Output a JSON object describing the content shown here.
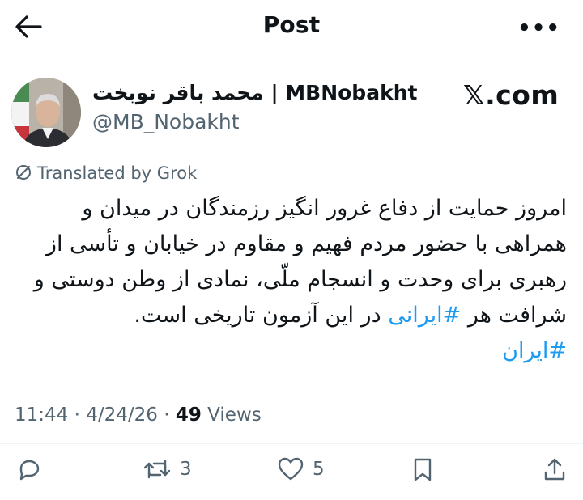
{
  "header": {
    "title": "Post",
    "back_icon": "back-arrow-icon",
    "more_icon": "more-icon"
  },
  "author": {
    "name": "محمد باقر نوبخت | MBNobakht",
    "handle": "@MB_Nobakht",
    "avatar_icon": "avatar"
  },
  "watermark": {
    "text": "𝕏.com"
  },
  "translation": {
    "label": "Translated by Grok",
    "icon": "translate-icon"
  },
  "post": {
    "text_lines": [
      "امروز حمایت از دفاع غرور انگیز رزمندگان در میدان و",
      "همراهی با حضور مردم فهیم و مقاوم در خیابان و تأسی از",
      "رهبری برای وحدت و انسجام ملّی، نمادی از وطن دوستی و"
    ],
    "line4_before": "شرافت هر ",
    "line4_hashtag": "#ایرانی",
    "line4_after": " در این آزمون تاریخی است.",
    "hashtag_line": "#ایران"
  },
  "meta": {
    "time": "11:44",
    "sep1": " · ",
    "date": "4/24/26",
    "sep2": " · ",
    "views_count": "49",
    "views_label": " Views"
  },
  "actions": {
    "reply_count": "",
    "repost_count": "3",
    "like_count": "5"
  },
  "colors": {
    "link": "#1d9bf0",
    "secondary": "#536471",
    "text": "#0f1419"
  }
}
